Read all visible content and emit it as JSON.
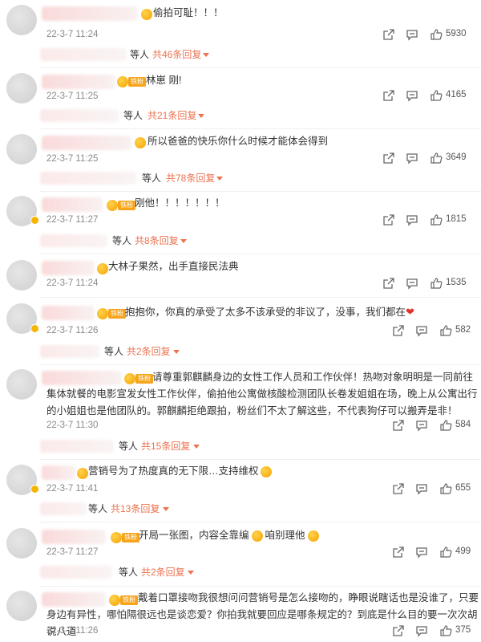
{
  "comments": [
    {
      "text": "偷拍可耻！！！",
      "date": "22-3-7 11:24",
      "likes": "5930",
      "reply_suffix": "等人",
      "reply_count": "共46条回复"
    },
    {
      "text": "林崽 刚!",
      "date": "22-3-7 11:25",
      "likes": "4165",
      "reply_suffix": "等人",
      "reply_count": "共21条回复"
    },
    {
      "text": "所以爸爸的快乐你什么时候才能体会得到",
      "date": "22-3-7 11:25",
      "likes": "3649",
      "reply_suffix": "等人",
      "reply_count": "共78条回复"
    },
    {
      "text": "刚他！！！！！！！",
      "date": "22-3-7 11:27",
      "likes": "1815",
      "reply_suffix": "等人",
      "reply_count": "共8条回复"
    },
    {
      "text": "大林子果然，出手直接民法典",
      "date": "22-3-7 11:24",
      "likes": "1535"
    },
    {
      "text": "抱抱你，你真的承受了太多不该承受的非议了，没事，我们都在",
      "date": "22-3-7 11:26",
      "likes": "582",
      "reply_suffix": "等人",
      "reply_count": "共2条回复"
    },
    {
      "text": "请尊重郭麒麟身边的女性工作人员和工作伙伴！热吻对象明明是一同前往集体就餐的电影宣发女性工作伙伴，偷拍他公寓做核酸检测团队长卷发姐姐在场，晚上从公寓出行的小姐姐也是他团队的。郭麒麟拒绝跟拍，粉丝们不太了解这些，不代表狗仔可以搬弄是非！",
      "date": "22-3-7 11:30",
      "likes": "584",
      "reply_suffix": "等人",
      "reply_count": "共15条回复"
    },
    {
      "text": "营销号为了热度真的无下限…支持维权",
      "date": "22-3-7 11:41",
      "likes": "655",
      "reply_suffix": "等人",
      "reply_count": "共13条回复"
    },
    {
      "text": "开局一张图，内容全靠编",
      "text2": "咱别理他",
      "date": "22-3-7 11:27",
      "likes": "499",
      "reply_suffix": "等人",
      "reply_count": "共2条回复"
    },
    {
      "text": "戴着口罩接吻我很想问问营销号是怎么接吻的，睁眼说瞎话也是没谁了，只要身边有异性，哪怕隔很远也是谈恋爱？你拍我就要回应是哪条规定的？到底是什么目的要一次次胡说八道",
      "date": "22-3-7 11:26",
      "likes": "375"
    }
  ],
  "fan_badge_label": "铁粉",
  "colors": {
    "reply_accent": "#eb7350",
    "badge": "#f7a41b",
    "heart": "#e0332f"
  },
  "icons": {
    "share": "share-icon",
    "comment": "comment-icon",
    "like": "thumbs-up-icon",
    "heart": "heart-icon"
  }
}
